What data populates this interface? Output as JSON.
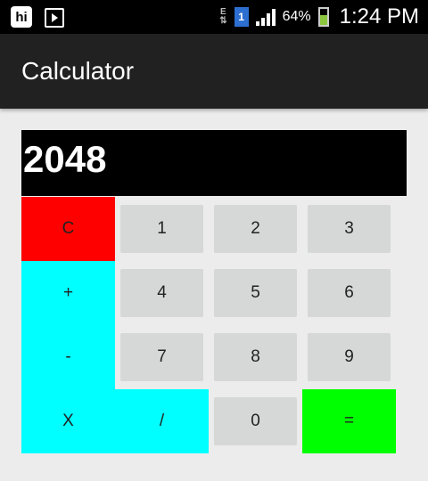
{
  "status_bar": {
    "app_icon_text": "hi",
    "network_type": "E",
    "sim_slot": "1",
    "battery_percent": "64%",
    "time": "1:24 PM"
  },
  "app_bar": {
    "title": "Calculator"
  },
  "display": {
    "value": "2048"
  },
  "keys": {
    "clear": "C",
    "one": "1",
    "two": "2",
    "three": "3",
    "plus": "+",
    "four": "4",
    "five": "5",
    "six": "6",
    "minus": "-",
    "seven": "7",
    "eight": "8",
    "nine": "9",
    "multiply": "X",
    "divide": "/",
    "zero": "0",
    "equals": "="
  },
  "colors": {
    "clear_key": "#ff0000",
    "operator_key": "#00ffff",
    "equals_key": "#00ff00",
    "number_key": "#d6d7d7",
    "display_bg": "#000000",
    "app_bar_bg": "#212121"
  }
}
